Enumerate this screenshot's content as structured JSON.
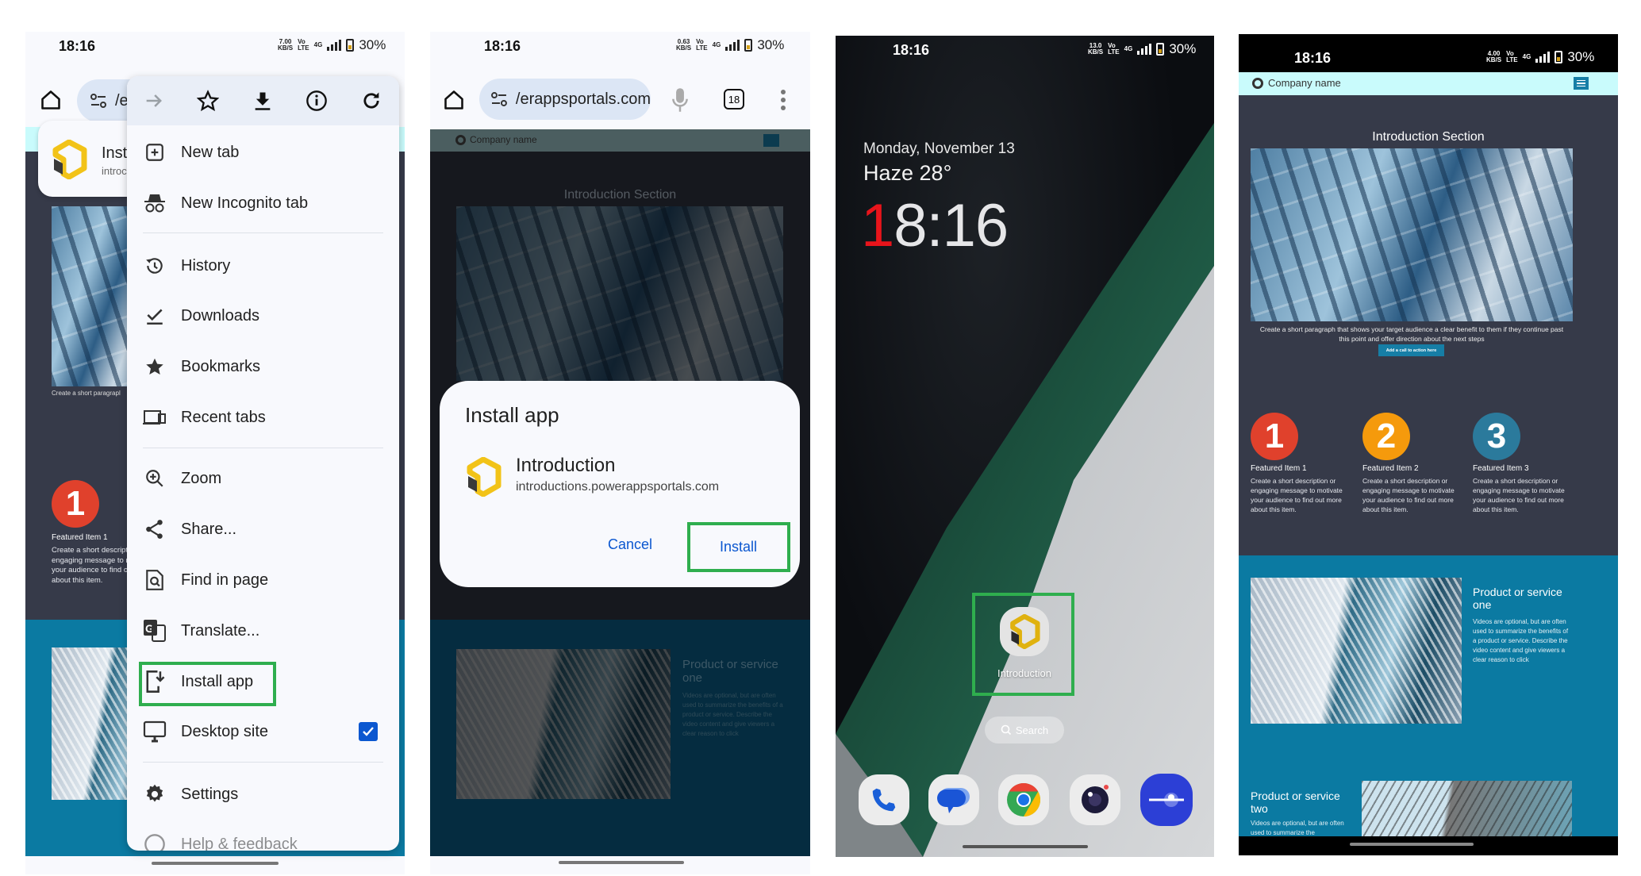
{
  "menu_screen": {
    "status": {
      "time": "18:16",
      "speed": "7.00",
      "speed_unit": "KB/S",
      "volte": "Vo",
      "lte": "LTE",
      "net": "4G",
      "battery": "30%"
    },
    "url_fragment": "/er",
    "banner": {
      "title": "Inst",
      "subtitle": "introc"
    },
    "page": {
      "caption": "Create a short paragrapl",
      "feature_number": "1",
      "feature_title": "Featured Item 1",
      "feature_desc": [
        "Create a short descriptio",
        "engaging message to m",
        "your audience to find ou",
        "about this item."
      ]
    },
    "menu_top_icons": [
      "forward-icon",
      "star-icon",
      "download-icon",
      "info-icon",
      "refresh-icon"
    ],
    "menu_items": [
      {
        "label": "New tab",
        "icon": "new-tab-icon"
      },
      {
        "label": "New Incognito tab",
        "icon": "incognito-icon"
      },
      {
        "label": "History",
        "icon": "history-icon"
      },
      {
        "label": "Downloads",
        "icon": "downloads-icon"
      },
      {
        "label": "Bookmarks",
        "icon": "bookmarks-icon"
      },
      {
        "label": "Recent tabs",
        "icon": "recent-tabs-icon"
      },
      {
        "label": "Zoom",
        "icon": "zoom-icon"
      },
      {
        "label": "Share...",
        "icon": "share-icon"
      },
      {
        "label": "Find in page",
        "icon": "find-icon"
      },
      {
        "label": "Translate...",
        "icon": "translate-icon"
      },
      {
        "label": "Install app",
        "icon": "install-app-icon",
        "highlighted": true
      },
      {
        "label": "Desktop site",
        "icon": "desktop-icon",
        "checked": true
      },
      {
        "label": "Settings",
        "icon": "settings-icon"
      },
      {
        "label": "Help & feedback",
        "icon": "help-icon"
      }
    ]
  },
  "dialog_screen": {
    "status": {
      "time": "18:16",
      "speed": "0.63",
      "speed_unit": "KB/S",
      "volte": "Vo",
      "lte": "LTE",
      "net": "4G",
      "battery": "30%"
    },
    "url": "/erappsportals.com",
    "tab_count": "18",
    "page": {
      "company": "Company name",
      "section_title": "Introduction Section",
      "product_title": "Product or service one",
      "product_desc": "Videos are optional, but are often used to summarize the benefits of a product or service. Describe the video content and give viewers a clear reason to click"
    },
    "dialog": {
      "title": "Install app",
      "app_name": "Introduction",
      "app_url": "introductions.powerappsportals.com",
      "cancel": "Cancel",
      "install": "Install"
    }
  },
  "homescreen": {
    "status": {
      "time": "18:16",
      "speed": "13.0",
      "speed_unit": "KB/S",
      "volte": "Vo",
      "lte": "LTE",
      "net": "4G",
      "battery": "30%"
    },
    "date": "Monday, November 13",
    "weather": "Haze 28°",
    "clock_first": "1",
    "clock_rest": "8:16",
    "app_label": "Introduction",
    "search_label": "Search",
    "dock": [
      "phone-icon",
      "messages-icon",
      "chrome-icon",
      "camera-icon",
      "browser-icon"
    ],
    "colors": {
      "clock_accent": "#e8141b"
    }
  },
  "app_screen": {
    "status": {
      "time": "18:16",
      "speed": "4.00",
      "speed_unit": "KB/S",
      "volte": "Vo",
      "lte": "LTE",
      "net": "4G",
      "battery": "30%"
    },
    "company": "Company name",
    "section_title": "Introduction Section",
    "intro_paragraph": "Create a short paragraph that shows your target audience a clear benefit to them if they continue past this point and offer direction about the next steps",
    "cta": "Add a call to action here",
    "features": [
      {
        "number": "1",
        "title": "Featured Item 1",
        "desc": "Create a short description or engaging message to motivate your audience to find out more about this item.",
        "color": "#e0412c"
      },
      {
        "number": "2",
        "title": "Featured Item 2",
        "desc": "Create a short description or engaging message to motivate your audience to find out more about this item.",
        "color": "#f59a0c"
      },
      {
        "number": "3",
        "title": "Featured Item 3",
        "desc": "Create a short description or engaging message to motivate your audience to find out more about this item.",
        "color": "#2b7a9c"
      }
    ],
    "products": [
      {
        "title": "Product or service one",
        "desc": "Videos are optional, but are often used to summarize the benefits of a product or service. Describe the video content and give viewers a clear reason to click"
      },
      {
        "title": "Product or service two",
        "desc": "Videos are optional, but are often used to summarize the"
      }
    ],
    "colors": {
      "header": "#c9fbfc",
      "dark": "#363a49",
      "teal": "#0b7aa2"
    }
  },
  "colors": {
    "highlight_box": "#2fae4e",
    "link_blue": "#0b57d0"
  }
}
